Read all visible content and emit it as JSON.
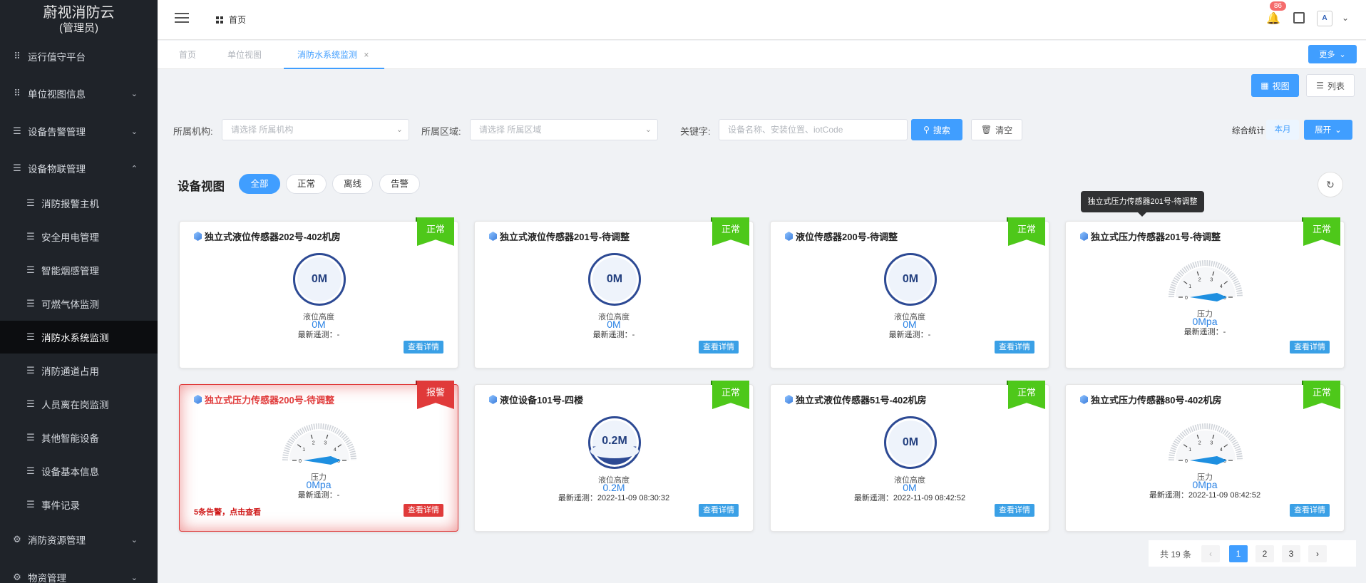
{
  "sidebar": {
    "title": "蔚视消防云",
    "role": "(管理员)",
    "items": [
      {
        "label": "运行值守平台",
        "icon": "grid-icon",
        "arrow": ""
      },
      {
        "label": "单位视图信息",
        "icon": "grid-icon",
        "arrow": "⌄"
      },
      {
        "label": "设备告警管理",
        "icon": "list-icon",
        "arrow": "⌄"
      },
      {
        "label": "设备物联管理",
        "icon": "list-icon",
        "arrow": "⌃"
      },
      {
        "label": "消防报警主机",
        "icon": "list-icon",
        "arrow": ""
      },
      {
        "label": "安全用电管理",
        "icon": "list-icon",
        "arrow": ""
      },
      {
        "label": "智能烟感管理",
        "icon": "list-icon",
        "arrow": ""
      },
      {
        "label": "可燃气体监测",
        "icon": "list-icon",
        "arrow": ""
      },
      {
        "label": "消防水系统监测",
        "icon": "list-icon",
        "arrow": ""
      },
      {
        "label": "消防通道占用",
        "icon": "list-icon",
        "arrow": ""
      },
      {
        "label": "人员离在岗监测",
        "icon": "list-icon",
        "arrow": ""
      },
      {
        "label": "其他智能设备",
        "icon": "list-icon",
        "arrow": ""
      },
      {
        "label": "设备基本信息",
        "icon": "list-icon",
        "arrow": ""
      },
      {
        "label": "事件记录",
        "icon": "list-icon",
        "arrow": ""
      },
      {
        "label": "消防资源管理",
        "icon": "gear-icon",
        "arrow": "⌄"
      },
      {
        "label": "物资管理",
        "icon": "gear-icon",
        "arrow": "⌄"
      }
    ],
    "active_index": 8
  },
  "topbar": {
    "breadcrumb": "首页",
    "notification_count": "86",
    "avatar_text": "A"
  },
  "tabs": {
    "items": [
      {
        "label": "首页"
      },
      {
        "label": "单位视图"
      },
      {
        "label": "消防水系统监测",
        "close": "×"
      }
    ],
    "more_label": "更多"
  },
  "view_toggle": {
    "view_label": "视图",
    "list_label": "列表"
  },
  "filters": {
    "org_label": "所属机构:",
    "org_placeholder": "请选择 所属机构",
    "area_label": "所属区域:",
    "area_placeholder": "请选择 所属区域",
    "keyword_label": "关键字:",
    "keyword_placeholder": "设备名称、安装位置、iotCode",
    "search_label": "搜索",
    "clear_label": "清空",
    "stat_label": "综合统计",
    "stat_value": "本月",
    "expand_label": "展开"
  },
  "section": {
    "title": "设备视图",
    "pills": [
      "全部",
      "正常",
      "离线",
      "告警"
    ],
    "active_pill": 0
  },
  "tooltip": "独立式压力传感器201号-待调整",
  "devices": [
    {
      "title": "独立式液位传感器202号-402机房",
      "type": "level",
      "status": "正常",
      "display": "0M",
      "label": "液位高度",
      "value": "0M",
      "latest": "最新遥测：-",
      "detail": "查看详情",
      "level": 0
    },
    {
      "title": "独立式液位传感器201号-待调整",
      "type": "level",
      "status": "正常",
      "display": "0M",
      "label": "液位高度",
      "value": "0M",
      "latest": "最新遥测：-",
      "detail": "查看详情",
      "level": 0
    },
    {
      "title": "液位传感器200号-待调整",
      "type": "level",
      "status": "正常",
      "display": "0M",
      "label": "液位高度",
      "value": "0M",
      "latest": "最新遥测：-",
      "detail": "查看详情",
      "level": 0
    },
    {
      "title": "独立式压力传感器201号-待调整",
      "type": "pressure",
      "status": "正常",
      "label": "压力",
      "value": "0Mpa",
      "latest": "最新遥测：-",
      "detail": "查看详情",
      "ticks": [
        "0",
        "1",
        "2",
        "3",
        "4",
        "5"
      ]
    },
    {
      "title": "独立式压力传感器200号-待调整",
      "type": "pressure",
      "status": "报警",
      "label": "压力",
      "value": "0Mpa",
      "latest": "最新遥测：-",
      "detail": "查看详情",
      "alarm_text": "5条告警，点击查看",
      "ticks": [
        "0",
        "1",
        "2",
        "3",
        "4",
        "5"
      ]
    },
    {
      "title": "液位设备101号-四楼",
      "type": "level",
      "status": "正常",
      "display": "0.2M",
      "label": "液位高度",
      "value": "0.2M",
      "latest": "最新遥测：2022-11-09 08:30:32",
      "detail": "查看详情",
      "level": 0.4
    },
    {
      "title": "独立式液位传感器51号-402机房",
      "type": "level",
      "status": "正常",
      "display": "0M",
      "label": "液位高度",
      "value": "0M",
      "latest": "最新遥测：2022-11-09 08:42:52",
      "detail": "查看详情",
      "level": 0
    },
    {
      "title": "独立式压力传感器80号-402机房",
      "type": "pressure",
      "status": "正常",
      "label": "压力",
      "value": "0Mpa",
      "latest": "最新遥测：2022-11-09 08:42:52",
      "detail": "查看详情",
      "ticks": [
        "0",
        "1",
        "2",
        "3",
        "4",
        "5"
      ]
    }
  ],
  "pagination": {
    "total": "共 19 条",
    "pages": [
      "1",
      "2",
      "3"
    ],
    "current": "1",
    "prev": "‹",
    "next": "›"
  },
  "colors": {
    "primary": "#409eff",
    "normal": "#4ec81a",
    "alarm": "#e03a3a",
    "sidebar": "#1f2329"
  }
}
